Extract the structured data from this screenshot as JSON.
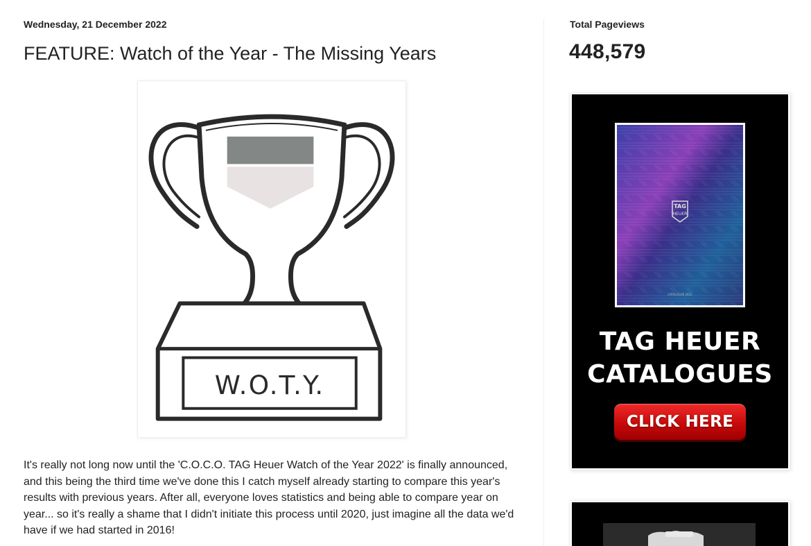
{
  "post": {
    "date_header": "Wednesday, 21 December 2022",
    "title": "FEATURE: Watch of the Year - The Missing Years",
    "image": {
      "icon": "trophy-icon",
      "plaque_text": "W.O.T.Y."
    },
    "body": "It's really not long now until the 'C.O.C.O. TAG Heuer Watch of the Year 2022' is finally announced, and this being the third time we've done this I catch myself already starting to compare this year's results with previous years. After all, everyone loves statistics and being able to compare year on year... so it's really a shame that I didn't initiate this process until 2020, just imagine all the data we'd have if we had started in 2016!"
  },
  "sidebar": {
    "pageviews": {
      "title": "Total Pageviews",
      "count": "448,579"
    },
    "ad": {
      "cover_logo_line1": "TAG",
      "cover_logo_line2": "HEUER",
      "cover_caption": "CATALOGUE 2022",
      "headline_line1": "TAG HEUER",
      "headline_line2": "CATALOGUES",
      "button_label": "CLICK HERE",
      "button_color": "#c80a0a"
    }
  },
  "colors": {
    "text": "#222222",
    "ad_background": "#000000"
  }
}
